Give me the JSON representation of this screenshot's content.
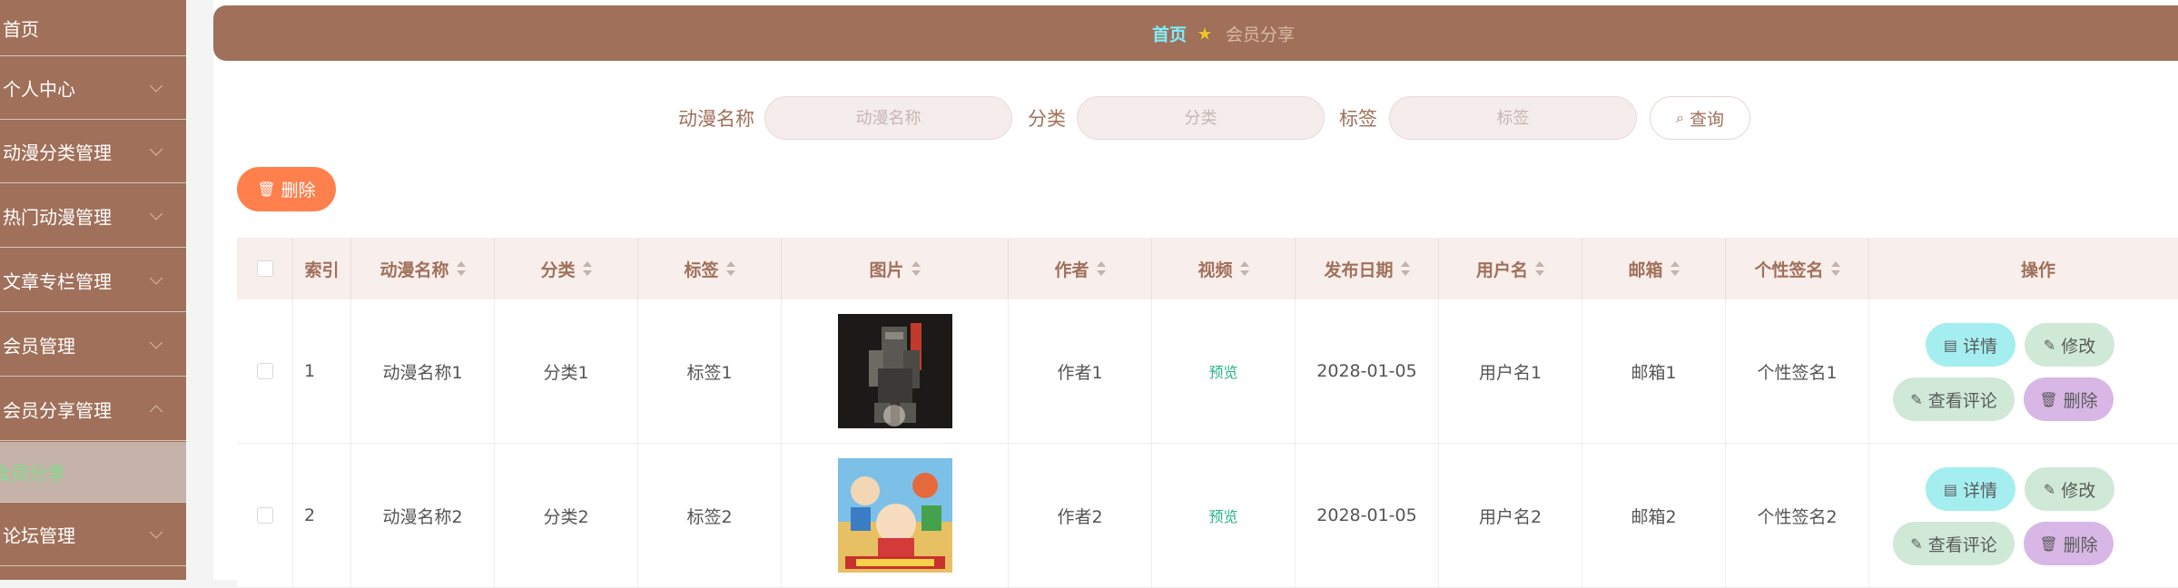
{
  "sidebar": {
    "items": [
      {
        "label": "首页",
        "chevron": false
      },
      {
        "label": "个人中心",
        "chevron": true
      },
      {
        "label": "动漫分类管理",
        "chevron": true
      },
      {
        "label": "热门动漫管理",
        "chevron": true
      },
      {
        "label": "文章专栏管理",
        "chevron": true
      },
      {
        "label": "会员管理",
        "chevron": true
      },
      {
        "label": "会员分享管理",
        "chevron": true,
        "expanded": true
      },
      {
        "label": "会员分享",
        "active": true
      },
      {
        "label": "论坛管理",
        "chevron": true
      }
    ]
  },
  "breadcrumb": {
    "home": "首页",
    "current": "会员分享"
  },
  "search": {
    "fields": [
      {
        "label": "动漫名称",
        "placeholder": "动漫名称",
        "value": ""
      },
      {
        "label": "分类",
        "placeholder": "分类",
        "value": ""
      },
      {
        "label": "标签",
        "placeholder": "标签",
        "value": ""
      }
    ],
    "query_label": "查询"
  },
  "toolbar": {
    "delete_label": "删除"
  },
  "table": {
    "headers": [
      "索引",
      "动漫名称",
      "分类",
      "标签",
      "图片",
      "作者",
      "视频",
      "发布日期",
      "用户名",
      "邮箱",
      "个性签名",
      "操作"
    ],
    "rows": [
      {
        "index": "1",
        "name": "动漫名称1",
        "category": "分类1",
        "tag": "标签1",
        "author": "作者1",
        "video": "预览",
        "date": "2028-01-05",
        "username": "用户名1",
        "email": "邮箱1",
        "signature": "个性签名1"
      },
      {
        "index": "2",
        "name": "动漫名称2",
        "category": "分类2",
        "tag": "标签2",
        "author": "作者2",
        "video": "预览",
        "date": "2028-01-05",
        "username": "用户名2",
        "email": "邮箱2",
        "signature": "个性签名2"
      }
    ],
    "actions": {
      "detail": "详情",
      "edit": "修改",
      "comment": "查看评论",
      "delete": "删除"
    }
  },
  "colors": {
    "primary": "#a0705a",
    "accent": "#7ef0ff",
    "danger": "#ff7f4d",
    "video_link": "#27b38a"
  }
}
